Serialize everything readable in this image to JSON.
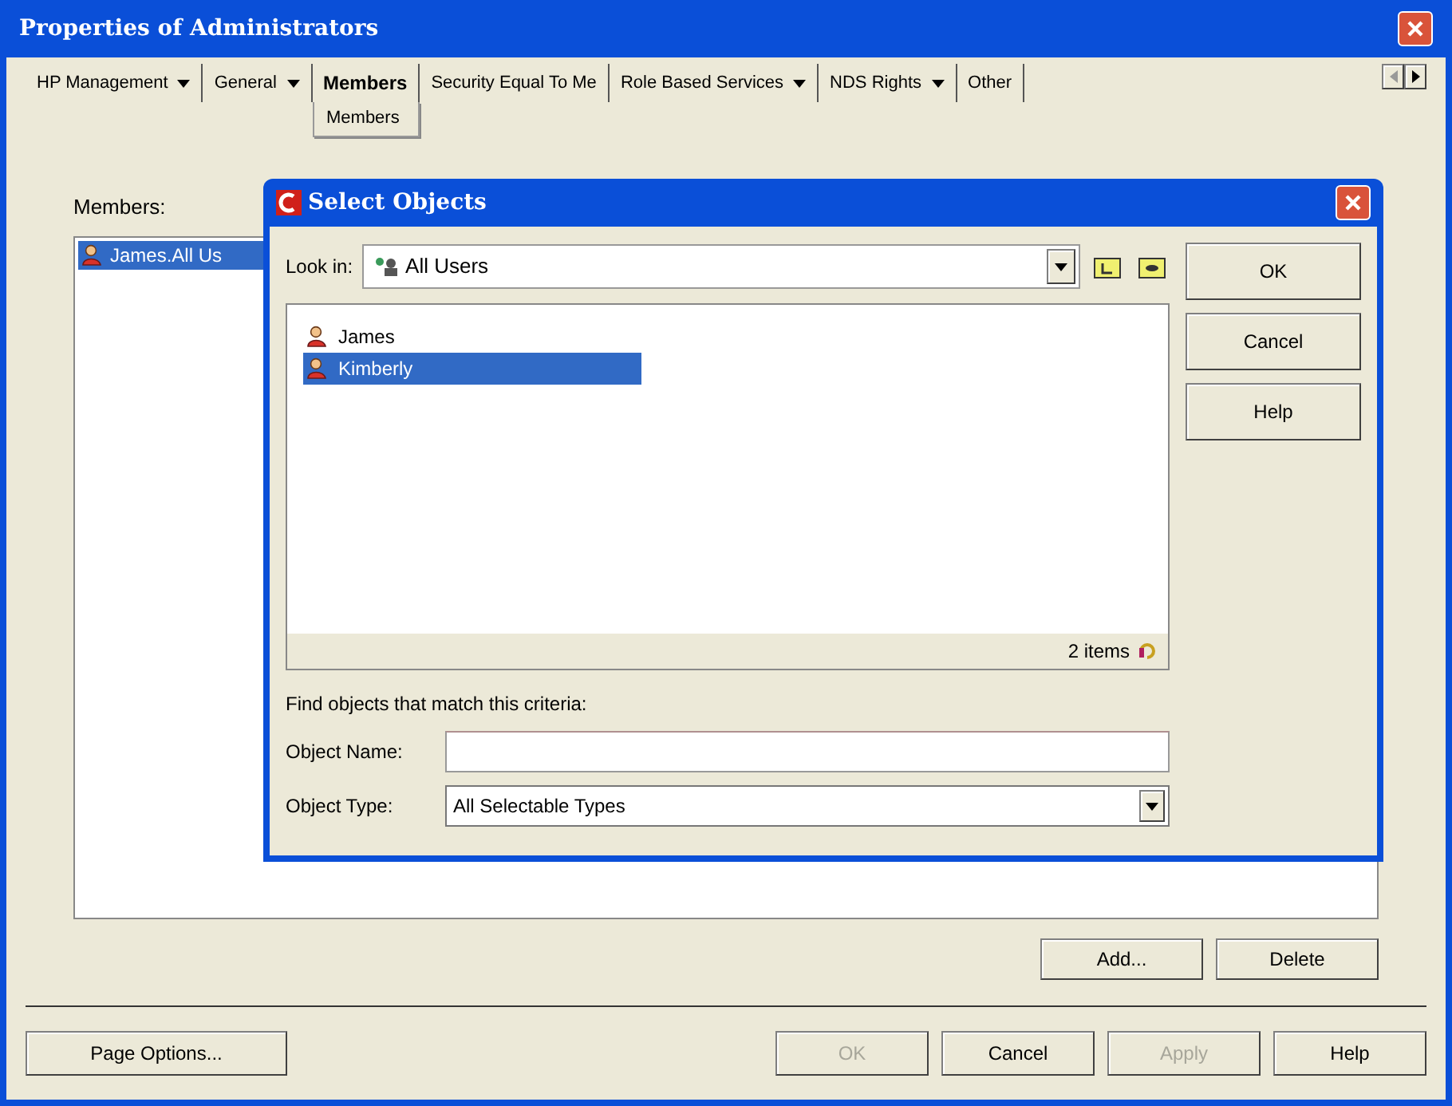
{
  "window": {
    "title": "Properties of Administrators"
  },
  "tabs": [
    {
      "label": "HP Management",
      "dropdown": true,
      "selected": false
    },
    {
      "label": "General",
      "dropdown": true,
      "selected": false
    },
    {
      "label": "Members",
      "dropdown": false,
      "selected": true
    },
    {
      "label": "Security Equal To Me",
      "dropdown": false,
      "selected": false
    },
    {
      "label": "Role Based Services",
      "dropdown": true,
      "selected": false
    },
    {
      "label": "NDS Rights",
      "dropdown": true,
      "selected": false
    },
    {
      "label": "Other",
      "dropdown": false,
      "selected": false
    }
  ],
  "subtab": "Members",
  "members": {
    "label": "Members:",
    "items": [
      {
        "name": "James.All Us",
        "selected": true
      }
    ],
    "buttons": [
      "Add...",
      "Delete"
    ]
  },
  "footer": {
    "left_button": "Page Options...",
    "buttons": [
      {
        "label": "OK",
        "disabled": true
      },
      {
        "label": "Cancel",
        "disabled": false
      },
      {
        "label": "Apply",
        "disabled": true
      },
      {
        "label": "Help",
        "disabled": false
      }
    ]
  },
  "dialog": {
    "title": "Select Objects",
    "look_in_label": "Look in:",
    "look_in_value": "All Users",
    "items": [
      {
        "name": "James",
        "selected": false
      },
      {
        "name": "Kimberly",
        "selected": true
      }
    ],
    "status": "2 items",
    "buttons": [
      "OK",
      "Cancel",
      "Help"
    ],
    "criteria_label": "Find objects that match this criteria:",
    "fields": [
      {
        "kind": "text",
        "label": "Object Name:"
      },
      {
        "kind": "select",
        "label": "Object Type:",
        "value": "All Selectable Types"
      }
    ]
  }
}
